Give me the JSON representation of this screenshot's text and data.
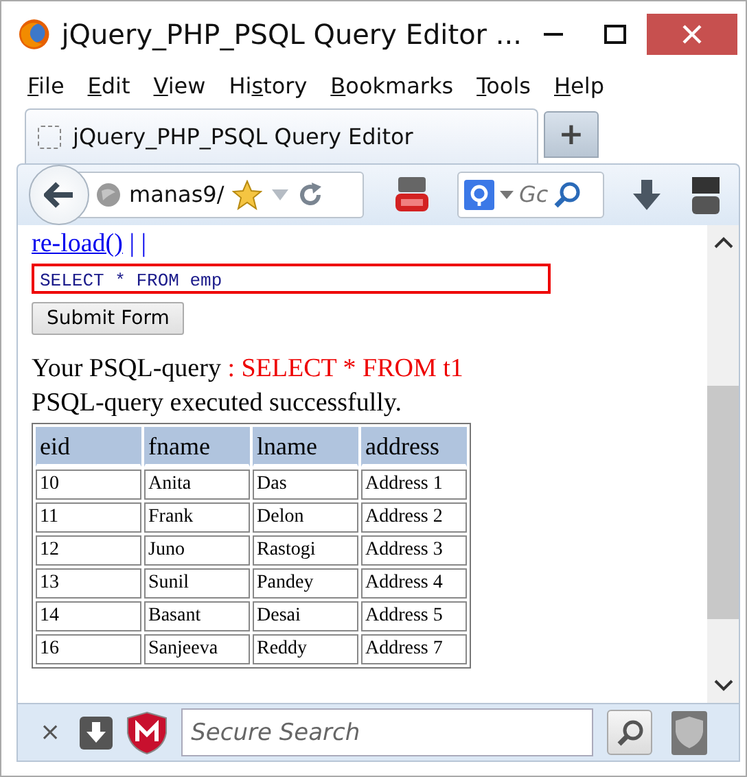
{
  "window": {
    "title": "jQuery_PHP_PSQL Query Editor ..."
  },
  "menu": [
    {
      "key": "F",
      "after": "ile"
    },
    {
      "key": "E",
      "after": "dit"
    },
    {
      "key": "V",
      "after": "iew"
    },
    {
      "before": "Hi",
      "key": "s",
      "after": "tory"
    },
    {
      "key": "B",
      "after": "ookmarks"
    },
    {
      "key": "T",
      "after": "ools"
    },
    {
      "key": "H",
      "after": "elp"
    }
  ],
  "tabs": [
    {
      "label": "jQuery_PHP_PSQL Query Editor",
      "selected": true
    }
  ],
  "new_tab": "+",
  "toolbar": {
    "url": "manas9/",
    "search_placeholder": "Gc"
  },
  "page": {
    "link": "re-load()",
    "separator": "| |",
    "query_input": "SELECT * FROM emp",
    "submit": "Submit Form",
    "query_label": "Your PSQL-query",
    "query_echo": ": SELECT * FROM t1",
    "status": "PSQL-query executed successfully."
  },
  "table": {
    "columns": [
      "eid",
      "fname",
      "lname",
      "address"
    ],
    "rows": [
      [
        "10",
        "Anita",
        "Das",
        "Address 1"
      ],
      [
        "11",
        "Frank",
        "Delon",
        "Address 2"
      ],
      [
        "12",
        "Juno",
        "Rastogi",
        "Address 3"
      ],
      [
        "13",
        "Sunil",
        "Pandey",
        "Address 4"
      ],
      [
        "14",
        "Basant",
        "Desai",
        "Address 5"
      ],
      [
        "16",
        "Sanjeeva",
        "Reddy",
        "Address 7"
      ]
    ]
  },
  "bottom_bar": {
    "close": "×",
    "search_placeholder": "Secure Search"
  }
}
